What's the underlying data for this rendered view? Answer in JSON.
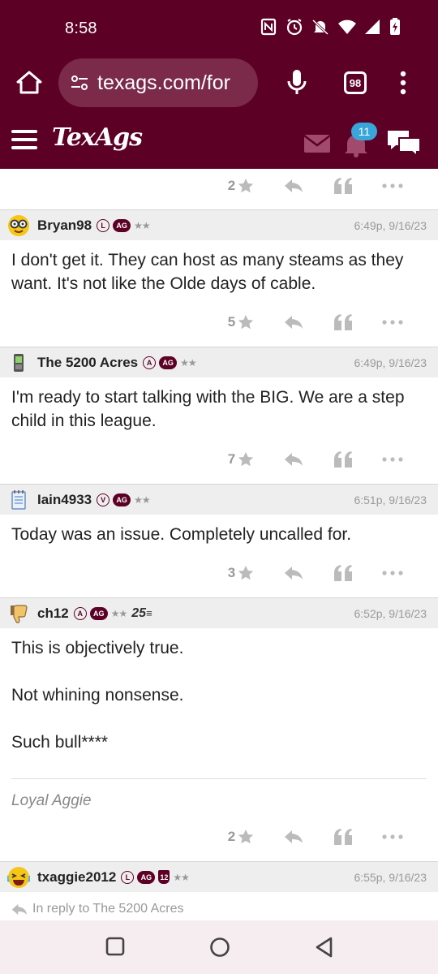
{
  "status_bar": {
    "time": "8:58"
  },
  "browser": {
    "url": "texags.com/for",
    "tab_count": "98"
  },
  "site": {
    "logo": "TexAgs",
    "notification_count": "11"
  },
  "top_post": {
    "star_count": "2"
  },
  "posts": [
    {
      "username": "Bryan98",
      "badges": [
        "L",
        "AG"
      ],
      "stars": "★★",
      "timestamp": "6:49p, 9/16/23",
      "body": [
        "I don't get it. They can host as many steams as they want. It's not like the Olde days of cable."
      ],
      "star_count": "5"
    },
    {
      "username": "The 5200 Acres",
      "badges": [
        "A",
        "AG"
      ],
      "stars": "★★",
      "timestamp": "6:49p, 9/16/23",
      "body": [
        "I'm ready to start talking with the BIG. We are a step child in this league."
      ],
      "star_count": "7"
    },
    {
      "username": "Iain4933",
      "badges": [
        "V",
        "AG"
      ],
      "stars": "★★",
      "timestamp": "6:51p, 9/16/23",
      "body": [
        "Today was an issue. Completely uncalled for."
      ],
      "star_count": "3"
    },
    {
      "username": "ch12",
      "badges": [
        "A",
        "AG"
      ],
      "stars": "★★",
      "extra_badge": "25",
      "timestamp": "6:52p, 9/16/23",
      "body": [
        "This is objectively true.",
        "Not whining nonsense.",
        "Such bull****"
      ],
      "signature": "Loyal Aggie",
      "star_count": "2"
    },
    {
      "username": "txaggie2012",
      "badges": [
        "L",
        "AG",
        "12"
      ],
      "stars": "★★",
      "timestamp": "6:55p, 9/16/23",
      "reply_to": "In reply to The 5200 Acres"
    }
  ]
}
